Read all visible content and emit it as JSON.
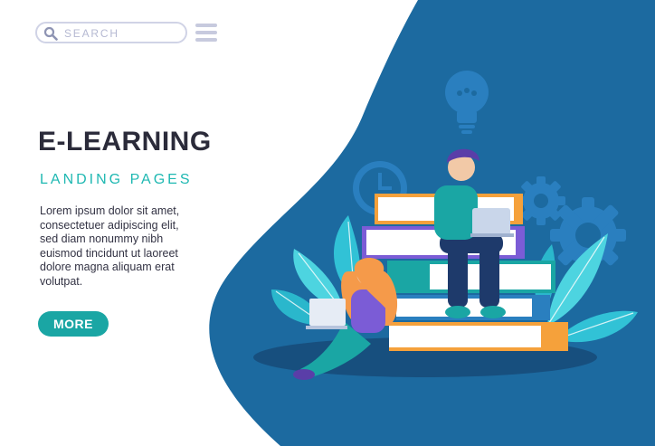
{
  "search": {
    "placeholder": "SEARCH",
    "icon": "search-icon"
  },
  "header": {
    "menu_icon": "hamburger-menu-icon"
  },
  "hero": {
    "title": "E-LEARNING",
    "subtitle": "LANDING PAGES",
    "body": "Lorem ipsum dolor sit amet,\nconsectetuer adipiscing elit,\nsed diam nonummy nibh\neuismod tincidunt ut laoreet\ndolore magna aliquam erat\nvolutpat.",
    "button_label": "MORE"
  },
  "colors": {
    "background": "#ffffff",
    "hero_blue": "#1c6aa0",
    "accent_teal": "#1aa6a4",
    "title_dark": "#2b2b3a",
    "subtitle_teal": "#1fb8b2"
  },
  "illustration": {
    "icons": [
      "lightbulb-icon",
      "clock-icon",
      "gear-icon",
      "laptop-icon",
      "book-stack-icon"
    ]
  }
}
